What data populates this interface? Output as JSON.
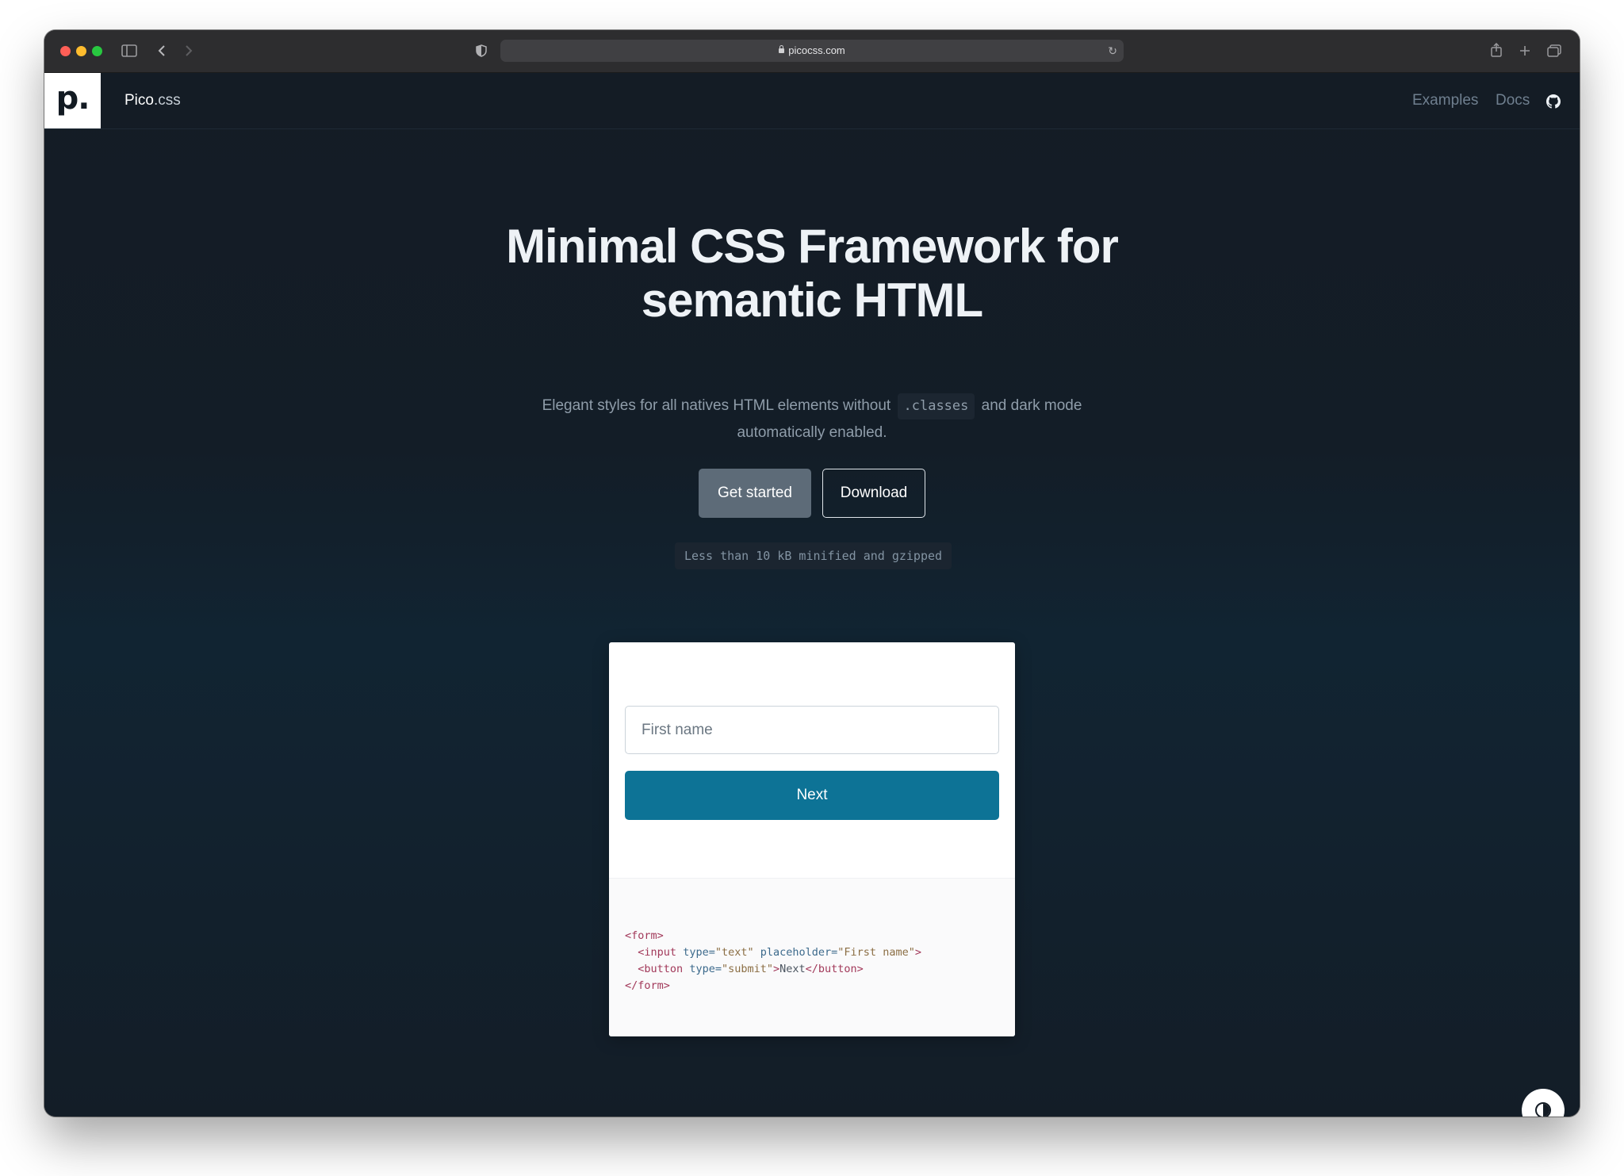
{
  "browser": {
    "url": "picocss.com"
  },
  "nav": {
    "brand_main": "Pico",
    "brand_suffix": ".css",
    "logo_text": "p.",
    "links": [
      "Examples",
      "Docs"
    ]
  },
  "hero": {
    "title_line1": "Minimal CSS Framework for",
    "title_line2": "semantic HTML",
    "subtitle_before": "Elegant styles for all natives HTML elements without",
    "subtitle_code": ".classes",
    "subtitle_after": "and dark mode",
    "subtitle_line2": "automatically enabled.",
    "primary_button": "Get started",
    "secondary_button": "Download",
    "size_note": "Less than 10 kB minified and gzipped"
  },
  "demo": {
    "input_placeholder": "First name",
    "button_label": "Next",
    "code": {
      "l1_open": "<form>",
      "l2_tag": "<input",
      "l2_attr1": "type=",
      "l2_val1": "\"text\"",
      "l2_attr2": "placeholder=",
      "l2_val2": "\"First name\"",
      "l2_close": ">",
      "l3_tag": "<button",
      "l3_attr1": "type=",
      "l3_val1": "\"submit\"",
      "l3_gt": ">",
      "l3_text": "Next",
      "l3_close": "</button>",
      "l4_close": "</form>"
    }
  },
  "colors": {
    "page_bg": "#131b24",
    "primary_button_bg": "#5d6b78",
    "demo_button_bg": "#0d7396"
  },
  "icons": {
    "sidebar": "sidebar-icon",
    "back": "chevron-left-icon",
    "forward": "chevron-right-icon",
    "privacy": "shield-icon",
    "reload": "reload-icon",
    "share": "share-icon",
    "new_tab": "plus-icon",
    "tabs": "tabs-overview-icon",
    "github": "github-icon",
    "theme": "theme-toggle-icon"
  }
}
